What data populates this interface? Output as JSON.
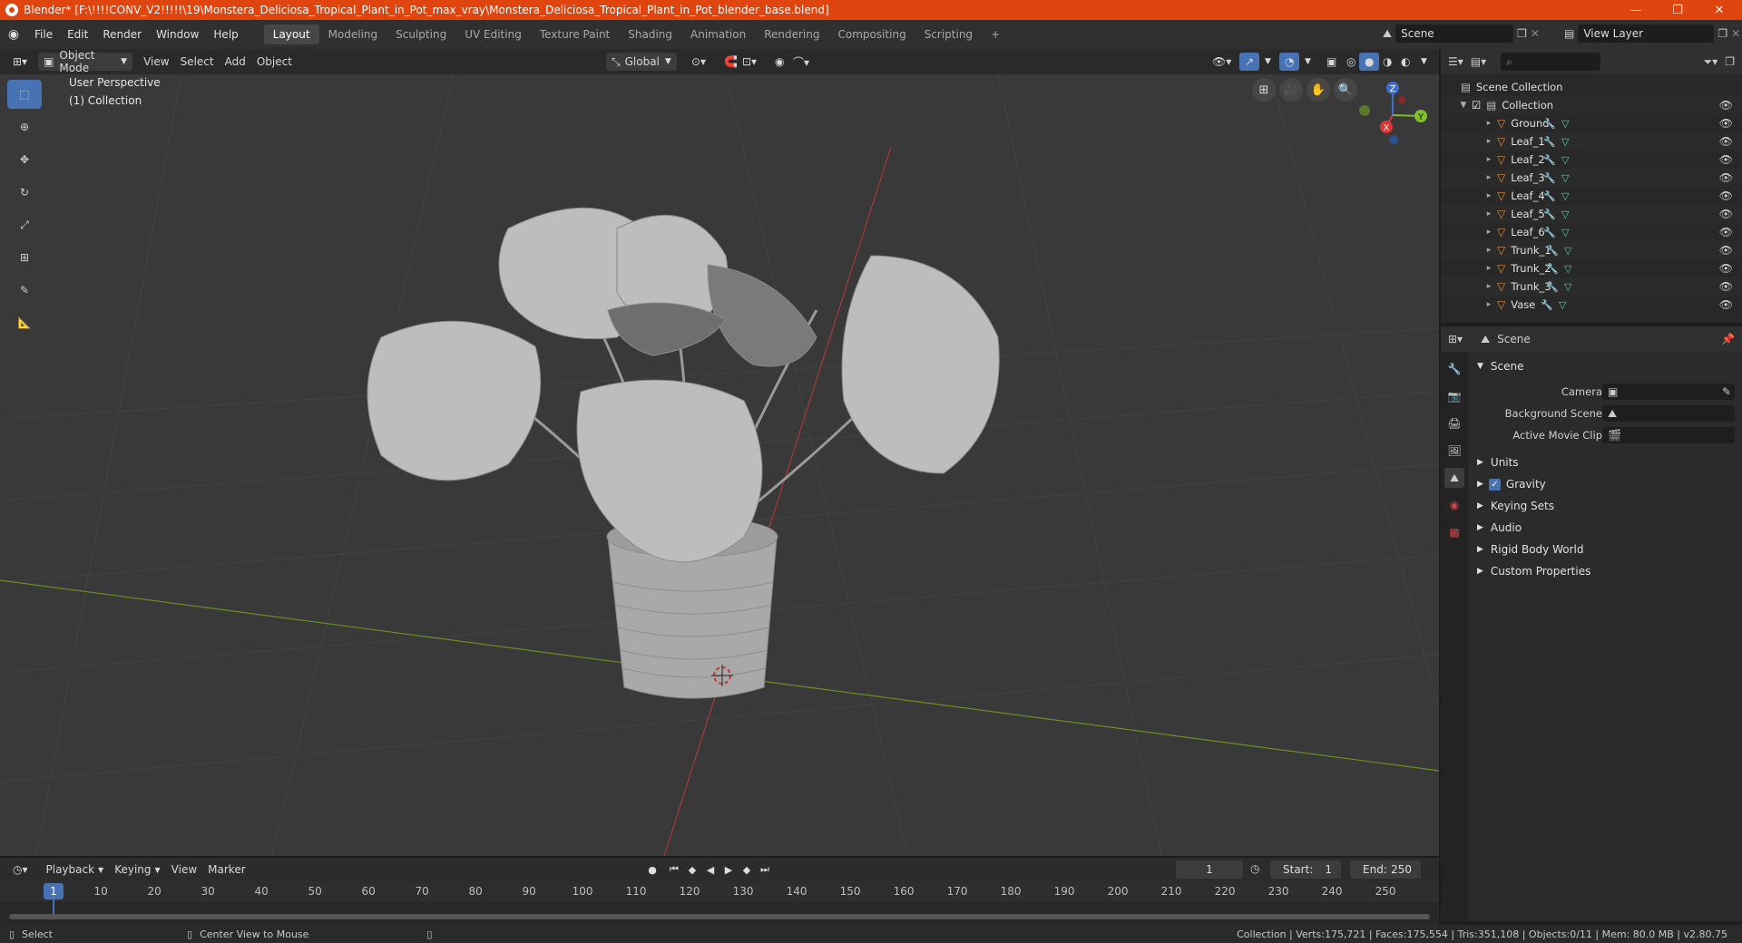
{
  "window": {
    "title": "Blender* [F:\\!!!!CONV_V2!!!!!\\19\\Monstera_Deliciosa_Tropical_Plant_in_Pot_max_vray\\Monstera_Deliciosa_Tropical_Plant_in_Pot_blender_base.blend]",
    "minimize": "—",
    "restore": "❐",
    "close": "✕"
  },
  "menu": [
    "File",
    "Edit",
    "Render",
    "Window",
    "Help"
  ],
  "workspaces": [
    "Layout",
    "Modeling",
    "Sculpting",
    "UV Editing",
    "Texture Paint",
    "Shading",
    "Animation",
    "Rendering",
    "Compositing",
    "Scripting"
  ],
  "workspace_add": "+",
  "scene_field": "Scene",
  "view_layer_field": "View Layer",
  "viewport_header": {
    "mode": "Object Mode",
    "menus": [
      "View",
      "Select",
      "Add",
      "Object"
    ],
    "orientation": "Global"
  },
  "viewport": {
    "perspective": "User Perspective",
    "collection": "(1) Collection",
    "gizmo": {
      "z": "Z",
      "y": "Y",
      "x": "X"
    }
  },
  "outliner": {
    "root": "Scene Collection",
    "collection": "Collection",
    "objects": [
      "Ground",
      "Leaf_1",
      "Leaf_2",
      "Leaf_3",
      "Leaf_4",
      "Leaf_5",
      "Leaf_6",
      "Trunk_1",
      "Trunk_2",
      "Trunk_3",
      "Vase"
    ]
  },
  "properties": {
    "header": "Scene",
    "panel": "Scene",
    "camera_label": "Camera",
    "background_scene_label": "Background Scene",
    "active_movie_clip_label": "Active Movie Clip",
    "sections": [
      "Units",
      "Gravity",
      "Keying Sets",
      "Audio",
      "Rigid Body World",
      "Custom Properties"
    ]
  },
  "timeline": {
    "menus": [
      "Playback",
      "Keying",
      "View",
      "Marker"
    ],
    "current_frame": "1",
    "start_label": "Start:",
    "start": "1",
    "end_label": "End:",
    "end": "250",
    "ticks": [
      "1",
      "10",
      "20",
      "30",
      "40",
      "50",
      "60",
      "70",
      "80",
      "90",
      "100",
      "110",
      "120",
      "130",
      "140",
      "150",
      "160",
      "170",
      "180",
      "190",
      "200",
      "210",
      "220",
      "230",
      "240",
      "250"
    ]
  },
  "status": {
    "select": "Select",
    "center": "Center View to Mouse",
    "stats": "Collection | Verts:175,721 | Faces:175,554 | Tris:351,108 | Objects:0/11 | Mem: 80.0 MB | v2.80.75"
  }
}
